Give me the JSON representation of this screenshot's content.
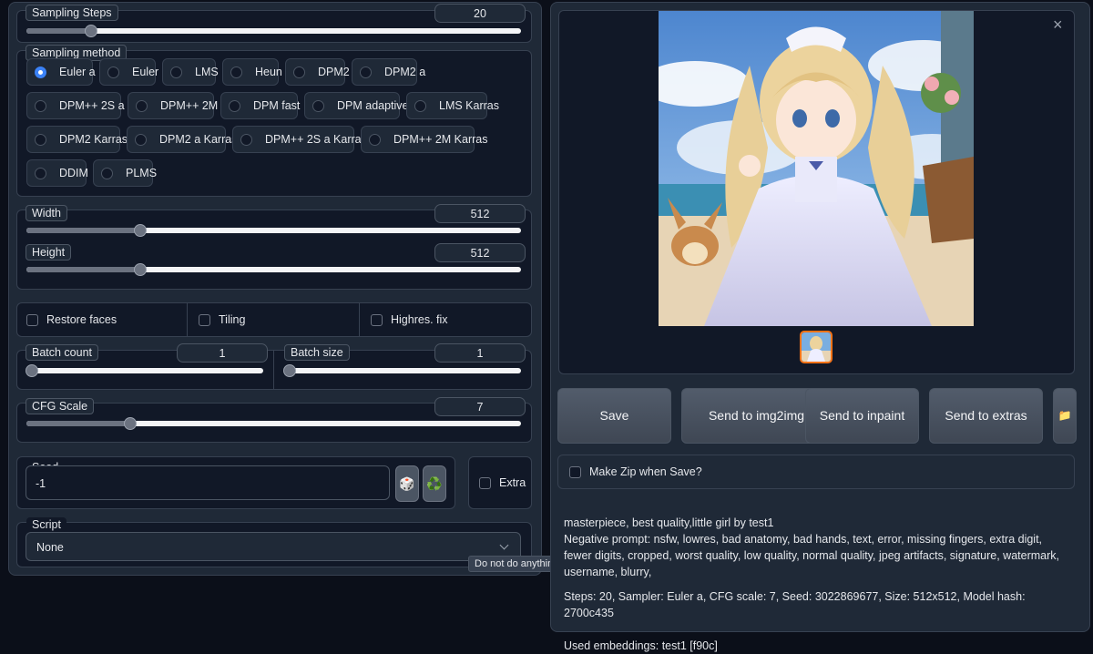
{
  "sampling_steps": {
    "label": "Sampling Steps",
    "value": "20",
    "fraction": 0.13
  },
  "sampling_method": {
    "label": "Sampling method",
    "selected": "Euler a",
    "options": [
      "Euler a",
      "Euler",
      "LMS",
      "Heun",
      "DPM2",
      "DPM2 a",
      "DPM++ 2S a",
      "DPM++ 2M",
      "DPM fast",
      "DPM adaptive",
      "LMS Karras",
      "DPM2 Karras",
      "DPM2 a Karras",
      "DPM++ 2S a Karras",
      "DPM++ 2M Karras",
      "DDIM",
      "PLMS"
    ]
  },
  "width": {
    "label": "Width",
    "value": "512",
    "fraction": 0.23
  },
  "height": {
    "label": "Height",
    "value": "512",
    "fraction": 0.23
  },
  "checkboxes": {
    "restore_faces": "Restore faces",
    "tiling": "Tiling",
    "highres_fix": "Highres. fix"
  },
  "batch_count": {
    "label": "Batch count",
    "value": "1",
    "fraction": 0.0
  },
  "batch_size": {
    "label": "Batch size",
    "value": "1",
    "fraction": 0.0
  },
  "cfg_scale": {
    "label": "CFG Scale",
    "value": "7",
    "fraction": 0.21
  },
  "seed": {
    "label": "Seed",
    "value": "-1",
    "dice_icon": "🎲",
    "recycle_icon": "♻️"
  },
  "extra": {
    "label": "Extra"
  },
  "script": {
    "label": "Script",
    "value": "None",
    "tooltip": "Do not do anything special"
  },
  "gallery": {
    "close_icon": "×",
    "folder_icon": "📁"
  },
  "buttons": {
    "save": "Save",
    "send_img2img": "Send to img2img",
    "send_inpaint": "Send to inpaint",
    "send_extras": "Send to extras"
  },
  "make_zip": "Make Zip when Save?",
  "generation_info": {
    "prompt": "masterpiece, best quality,little girl by test1",
    "negative": "Negative prompt: nsfw, lowres, bad anatomy, bad hands, text, error, missing fingers, extra digit, fewer digits, cropped, worst quality, low quality, normal quality, jpeg artifacts, signature, watermark, username, blurry,",
    "params": "Steps: 20, Sampler: Euler a, CFG scale: 7, Seed: 3022869677, Size: 512x512, Model hash: 2700c435",
    "embeddings": "Used embeddings: test1 [f90c]"
  },
  "colors": {
    "accent": "#3b82f6",
    "background": "#0b0f19",
    "panel": "#1f2937",
    "thumb_border": "#f97316"
  }
}
